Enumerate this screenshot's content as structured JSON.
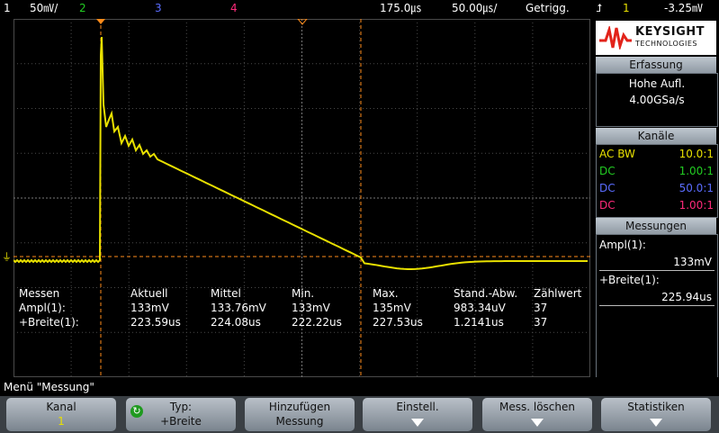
{
  "status": {
    "ch1_num": "1",
    "ch1_scale": "50㎷/",
    "ch2_num": "2",
    "ch3_num": "3",
    "ch4_num": "4",
    "time_pos": "175.0㎲",
    "timebase": "50.00㎲/",
    "trigger_state": "Getrigg.",
    "trigger_source": "1",
    "trigger_level": "-3.25㎷"
  },
  "brand": {
    "line1": "KEYSIGHT",
    "line2": "TECHNOLOGIES"
  },
  "acquisition": {
    "title": "Erfassung",
    "mode": "Hohe Aufl.",
    "rate": "4.00GSa/s"
  },
  "channels": {
    "title": "Kanäle",
    "items": [
      {
        "coupling": "AC BW",
        "ratio": "10.0:1",
        "color": "#e8e000"
      },
      {
        "coupling": "DC",
        "ratio": "1.00:1",
        "color": "#22cc22"
      },
      {
        "coupling": "DC",
        "ratio": "50.0:1",
        "color": "#5a6cff"
      },
      {
        "coupling": "DC",
        "ratio": "1.00:1",
        "color": "#ff2a7a"
      }
    ]
  },
  "measurements_panel": {
    "title": "Messungen",
    "m1_label": "Ampl(1):",
    "m1_value": "133mV",
    "m2_label": "+Breite(1):",
    "m2_value": "225.94us"
  },
  "stats_table": {
    "headers": [
      "Messen",
      "Aktuell",
      "Mittel",
      "Min.",
      "Max.",
      "Stand.-Abw.",
      "Zählwert"
    ],
    "rows": [
      [
        "Ampl(1):",
        "133mV",
        "133.76mV",
        "133mV",
        "135mV",
        "983.34uV",
        "37"
      ],
      [
        "+Breite(1):",
        "223.59us",
        "224.08us",
        "222.22us",
        "227.53us",
        "1.2141us",
        "37"
      ]
    ]
  },
  "menu": {
    "title": "Menü \"Messung\"",
    "keys": [
      {
        "l1": "Kanal",
        "l2": "1"
      },
      {
        "l1": "Typ:",
        "l2": "+Breite"
      },
      {
        "l1": "Hinzufügen",
        "l2": "Messung"
      },
      {
        "l1": "Einstell.",
        "l2": ""
      },
      {
        "l1": "Mess. löschen",
        "l2": ""
      },
      {
        "l1": "Statistiken",
        "l2": ""
      }
    ]
  },
  "colors": {
    "ch1": "#e8e000",
    "cursor": "#ff8c1a",
    "grid": "#4a4a4a"
  }
}
